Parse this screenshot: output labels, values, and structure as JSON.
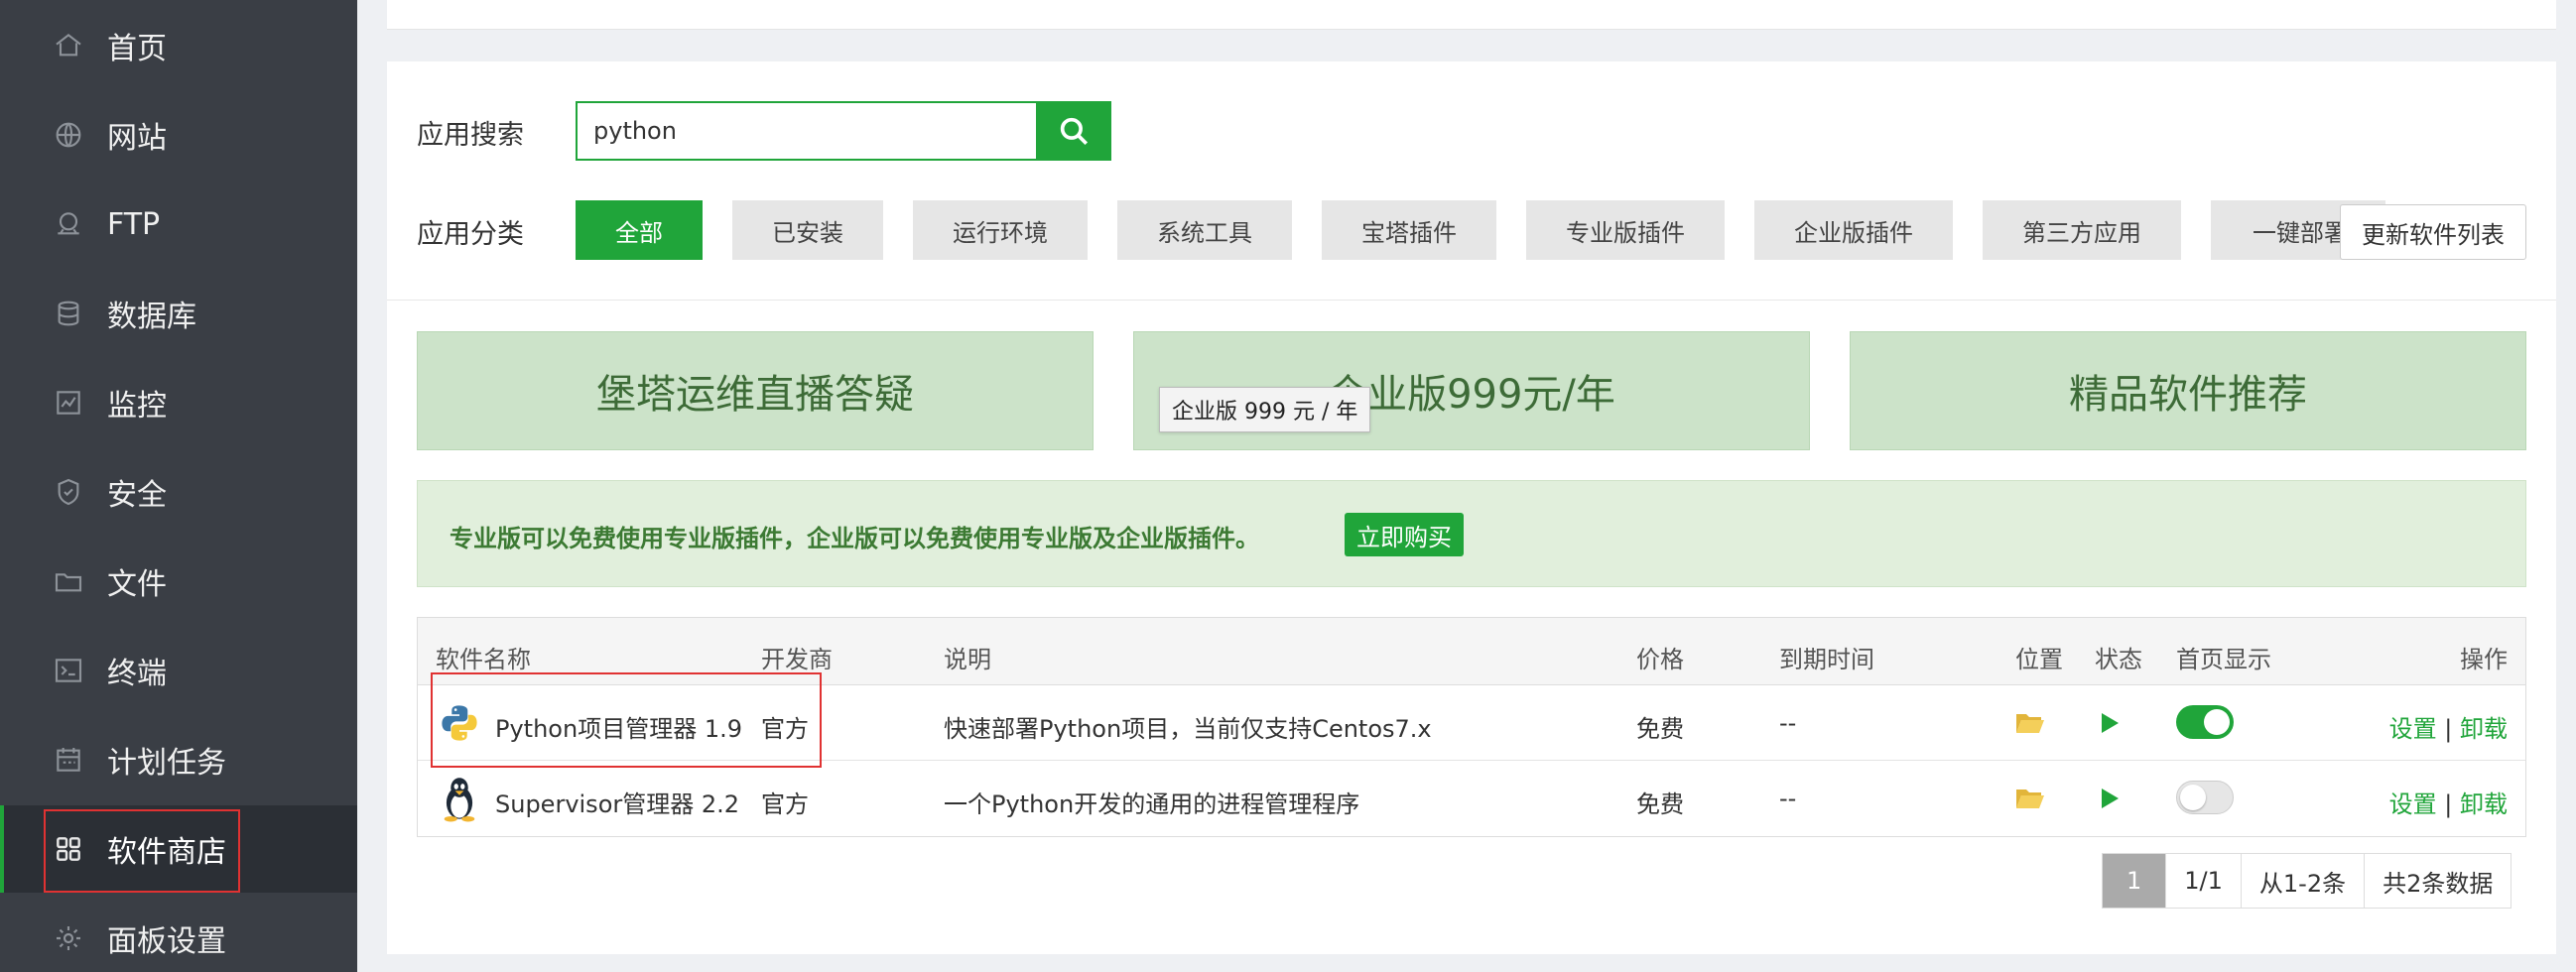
{
  "sidebar": {
    "items": [
      {
        "label": "首页",
        "icon": "home-icon"
      },
      {
        "label": "网站",
        "icon": "globe-icon"
      },
      {
        "label": "FTP",
        "icon": "ftp-icon"
      },
      {
        "label": "数据库",
        "icon": "database-icon"
      },
      {
        "label": "监控",
        "icon": "monitor-icon"
      },
      {
        "label": "安全",
        "icon": "shield-icon"
      },
      {
        "label": "文件",
        "icon": "folder-icon"
      },
      {
        "label": "终端",
        "icon": "terminal-icon"
      },
      {
        "label": "计划任务",
        "icon": "calendar-icon"
      },
      {
        "label": "软件商店",
        "icon": "grid-icon",
        "active": true
      },
      {
        "label": "面板设置",
        "icon": "gear-icon"
      }
    ]
  },
  "search": {
    "label": "应用搜索",
    "value": "python"
  },
  "categories": {
    "label": "应用分类",
    "items": [
      "全部",
      "已安装",
      "运行环境",
      "系统工具",
      "宝塔插件",
      "专业版插件",
      "企业版插件",
      "第三方应用",
      "一键部署"
    ],
    "update_label": "更新软件列表"
  },
  "banners": [
    "堡塔运维直播答疑",
    "企业版999元/年",
    "精品软件推荐"
  ],
  "tooltip": "企业版 999 元 / 年",
  "notice": {
    "text": "专业版可以免费使用专业版插件，企业版可以免费使用专业版及企业版插件。",
    "buy_label": "立即购买"
  },
  "table": {
    "headers": [
      "软件名称",
      "开发商",
      "说明",
      "价格",
      "到期时间",
      "位置",
      "状态",
      "首页显示",
      "操作"
    ],
    "rows": [
      {
        "name": "Python项目管理器 1.9",
        "developer": "官方",
        "description": "快速部署Python项目，当前仅支持Centos7.x",
        "price": "免费",
        "expiry": "--",
        "home_display": true,
        "op_settings": "设置",
        "op_sep": "|",
        "op_uninstall": "卸载",
        "icon": "python-icon"
      },
      {
        "name": "Supervisor管理器 2.2",
        "developer": "官方",
        "description": "一个Python开发的通用的进程管理程序",
        "price": "免费",
        "expiry": "--",
        "home_display": false,
        "op_settings": "设置",
        "op_sep": "|",
        "op_uninstall": "卸载",
        "icon": "linux-penguin-icon"
      }
    ]
  },
  "pagination": {
    "current": "1",
    "pages": "1/1",
    "range": "从1-2条",
    "total": "共2条数据"
  },
  "colors": {
    "accent": "#20a53a",
    "sidebar_bg": "#3a3e45",
    "highlight_box": "#e03232"
  }
}
